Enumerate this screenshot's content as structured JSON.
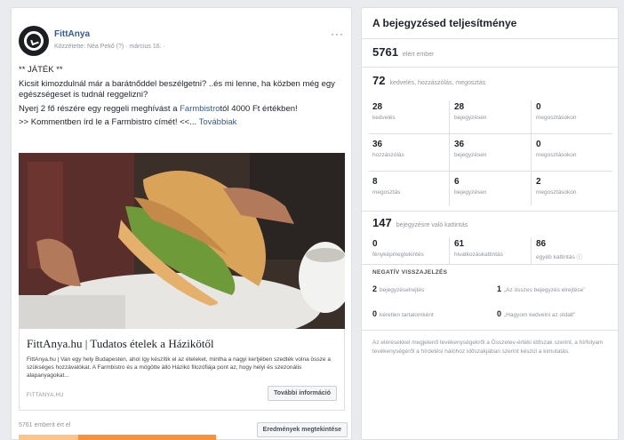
{
  "post": {
    "page_name": "FittAnya",
    "meta": "Közzétette: Néa Pekő (?) · március 16. ·",
    "more": "···",
    "text_line1": "** JÁTÉK **",
    "text_line2": "Kicsit kimozdulnál már a barátnőddel beszélgetni? ..és mi lenne, ha közben még egy egészségeset is tudnál reggelizni?",
    "text_line3_a": "Nyerj 2 fő részére egy reggeli meghívást a ",
    "text_line3_link": "Farmbistro",
    "text_line3_b": "tól 4000 Ft értékben!",
    "text_line4": ">> Kommentben írd le a Farmbistro címét! <<...",
    "see_more": "Továbbiak",
    "link_title": "FittAnya.hu | Tudatos ételek a Házikötől",
    "link_desc": "FittAnya.hu | Van egy hely Budapesten, ahol így készítik el az ételeket, mintha a nagyi kertjében szedték volna össze a szükséges hozzávalókat. A Farmbistro és a mögötte álló Házikó filozófiája pont az, hogy helyi és szezonális alapanyagokat...",
    "link_domain": "FITTANYA.HU",
    "link_button": "További információ",
    "reach_text": "5761 emberit ért el",
    "reach_fraction": 0.3,
    "boost_button": "Eredmények megtekintése"
  },
  "perf": {
    "title": "A bejegyzésed teljesítménye",
    "reached": "5761",
    "reached_label": "elért ember",
    "reactions": "72",
    "reactions_label": "kedvelés, hozzászólás, megosztás",
    "grid": [
      {
        "n": "28",
        "l": "kedvelés"
      },
      {
        "n": "28",
        "l": "bejegyzésen"
      },
      {
        "n": "0",
        "l": "megosztásokon"
      },
      {
        "n": "36",
        "l": "hozzászólás"
      },
      {
        "n": "36",
        "l": "bejegyzésen"
      },
      {
        "n": "0",
        "l": "megosztásokon"
      },
      {
        "n": "8",
        "l": "megosztás"
      },
      {
        "n": "6",
        "l": "bejegyzésen"
      },
      {
        "n": "2",
        "l": "megosztásokon"
      }
    ],
    "clicks": "147",
    "clicks_label": "bejegyzésre való kattintás",
    "click_grid": [
      {
        "n": "0",
        "l": "fényképmegtekintés"
      },
      {
        "n": "61",
        "l": "hivatkozáskattintás"
      },
      {
        "n": "86",
        "l": "egyéb kattintás ⓘ"
      }
    ],
    "neg_title": "NEGATÍV VISSZAJELZÉS",
    "neg": [
      {
        "n": "2",
        "l": "bejegyzéselrejtés"
      },
      {
        "n": "1",
        "l": "„Az összes bejegyzés elrejtése”"
      },
      {
        "n": "0",
        "l": "kéretlen tartalomként"
      },
      {
        "n": "0",
        "l": "„Hagyom kedvelni az oldalt”"
      }
    ],
    "note": "Az elérésekkel megjelenő tevékenységekről a Összetev-értéki időszak szerint, a hírfolyam tevékenységéről a hírdetési hálóhoz időszakjában szerint készül a kimutatás."
  },
  "colors": {
    "link": "#385898",
    "reach_bar": "#f7923b"
  }
}
